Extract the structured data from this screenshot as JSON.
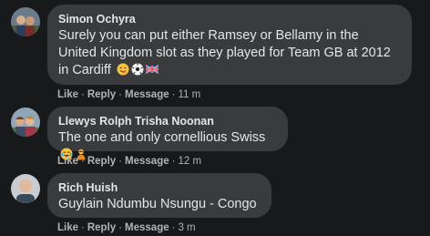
{
  "actions": {
    "like": "Like",
    "reply": "Reply",
    "message": "Message",
    "sep": "·"
  },
  "comments": [
    {
      "author": "Simon Ochyra",
      "lines": [
        "Surely you can put either Ramsey or Bellamy in the",
        "United Kingdom slot as they played for Team GB at 2012",
        "in Cardiff"
      ],
      "emojis": [
        "winking-face-tongue-icon",
        "soccer-ball-icon",
        "uk-flag-icon"
      ],
      "time": "11 m"
    },
    {
      "author": "Llewys Rolph Trisha Noonan",
      "lines": [
        "The one and only cornellious Swiss"
      ],
      "emojis": [
        "tears-of-joy-icon",
        "person-bowing-icon"
      ],
      "time": "12 m"
    },
    {
      "author": "Rich Huish",
      "lines": [
        "Guylain Ndumbu Nsungu - Congo"
      ],
      "emojis": [],
      "time": "3 m"
    }
  ]
}
